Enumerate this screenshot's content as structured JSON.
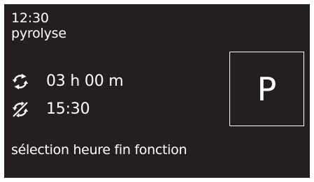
{
  "display": {
    "clock": "12:30",
    "program": "pyrolyse",
    "duration": {
      "icon": "cycle-arrows-icon",
      "value": "03 h 00 m"
    },
    "end_time": {
      "icon": "cycle-arrows-crossed-icon",
      "value": "15:30"
    },
    "mode": {
      "letter": "P"
    },
    "footer": "sélection heure fin fonction"
  },
  "colors": {
    "background": "#231f20",
    "foreground": "#ffffff",
    "frame": "#ffffff"
  }
}
